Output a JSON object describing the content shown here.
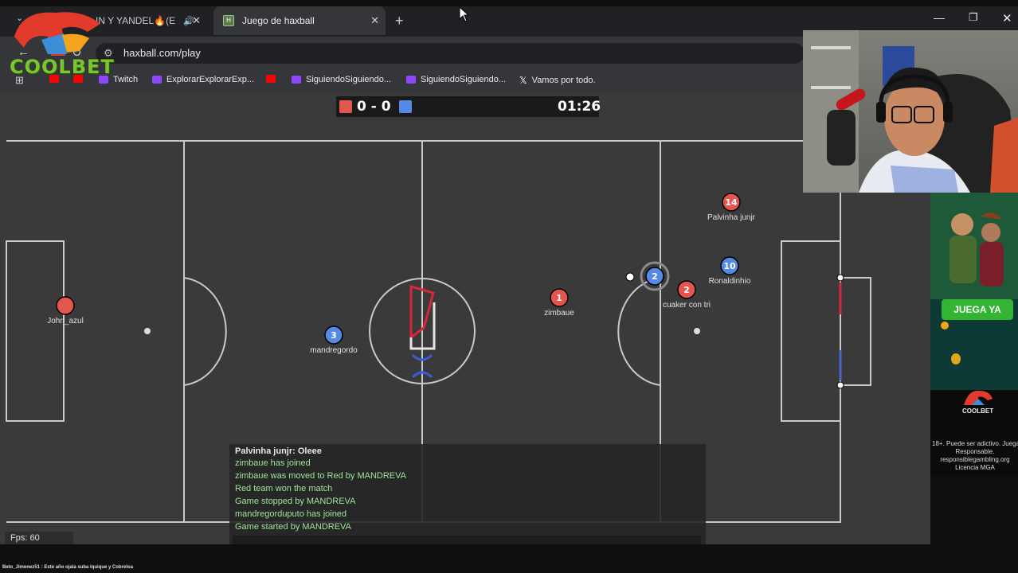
{
  "browser": {
    "tabs": [
      {
        "label": "IN Y YANDEL🔥(E"
      },
      {
        "label": "Juego de haxball"
      }
    ],
    "url": "haxball.com/play",
    "bookmarks": [
      {
        "label": "Twitch"
      },
      {
        "label": "ExplorarExplorarExp..."
      },
      {
        "label": "SiguiendoSiguiendo..."
      },
      {
        "label": "SiguiendoSiguiendo..."
      },
      {
        "label": "Vamos por todo."
      }
    ]
  },
  "scoreboard": {
    "score": "0 - 0",
    "time": "01:26",
    "red_color": "#e5554f",
    "blue_color": "#5688e5"
  },
  "players": [
    {
      "team": "red",
      "number": "",
      "name": "John_azul"
    },
    {
      "team": "blue",
      "number": "3",
      "name": "mandregordo"
    },
    {
      "team": "red",
      "number": "1",
      "name": "zimbaue"
    },
    {
      "team": "blue",
      "number": "2",
      "name": ""
    },
    {
      "team": "red",
      "number": "2",
      "name": "cuaker con tri"
    },
    {
      "team": "blue",
      "number": "10",
      "name": "Ronaldinhio"
    },
    {
      "team": "red",
      "number": "14",
      "name": "Palvinha junjr"
    }
  ],
  "chat": {
    "lines": [
      "Palvinha junjr: Oleee",
      "zimbaue has joined",
      "zimbaue was moved to Red by MANDREVA",
      "Red team won the match",
      "Game stopped by MANDREVA",
      "mandregorduputo has joined",
      "Game started by MANDREVA"
    ]
  },
  "fps": "Fps: 60",
  "overlay": {
    "brand": "COOLBET",
    "ad_cta": "JUEGA YA",
    "ad_brand": "COOLBET",
    "ad_disclaimer": [
      "18+. Puede ser adictivo. Juega",
      "Responsable.",
      "responsiblegambling.org",
      "Licencia MGA"
    ]
  },
  "ticker": "Beto_Jimenez51 : Este año ojala suba Iquique y Cobreloa"
}
